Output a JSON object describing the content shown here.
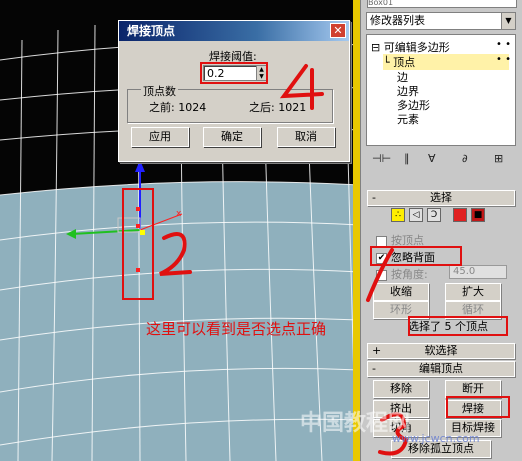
{
  "dialog": {
    "title": "焊接顶点",
    "threshold_label": "焊接阈值:",
    "threshold_value": "0.2",
    "group_label": "顶点数",
    "before_label": "之前: 1024",
    "after_label": "之后: 1021",
    "buttons": {
      "apply": "应用",
      "ok": "确定",
      "cancel": "取消"
    },
    "close": "✕"
  },
  "panel": {
    "object_name": "Box01",
    "modifier_list": "修改器列表",
    "stack": {
      "root": "可编辑多边形",
      "items": [
        "顶点",
        "边",
        "边界",
        "多边形",
        "元素"
      ],
      "selected": "顶点"
    },
    "rollouts": {
      "selection": "选择",
      "soft_selection": "软选择",
      "edit_vertices": "编辑顶点"
    },
    "by_vertex": "按顶点",
    "ignore_backfacing": "忽略背面",
    "by_angle": "按角度:",
    "angle_value": "45.0",
    "buttons": {
      "shrink": "收缩",
      "grow": "扩大",
      "ring": "环形",
      "loop": "循环",
      "remove": "移除",
      "break": "断开",
      "extrude": "挤出",
      "weld": "焊接",
      "chamfer": "切角",
      "target_weld": "目标焊接",
      "remove_isolated": "移除孤立顶点"
    },
    "status": "选择了 5 个顶点"
  },
  "annotations": {
    "note": "这里可以看到是否选点正确",
    "num_1": "1",
    "num_2": "2",
    "num_3": "3",
    "num_4": "4",
    "color": "#e01010"
  },
  "watermark": {
    "site": "www.jcwcn.com",
    "big": "中国教程网"
  }
}
